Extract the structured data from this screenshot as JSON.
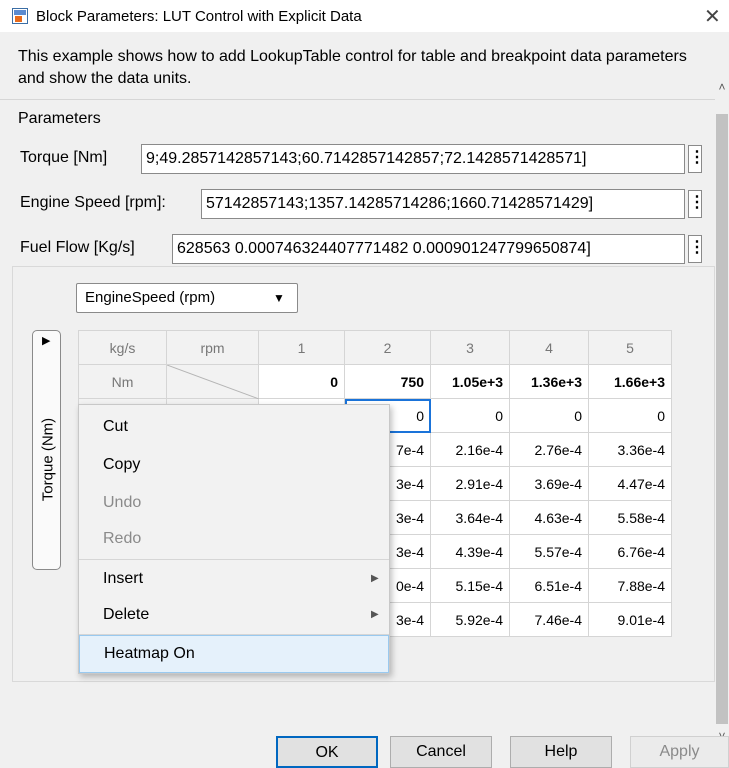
{
  "window": {
    "title": "Block Parameters: LUT Control with Explicit Data",
    "close_glyph": "✕",
    "icon": "simulink-block-icon"
  },
  "description": "This example shows how to add LookupTable control for table and breakpoint data  parameters and show the data units.",
  "parameters": {
    "title": "Parameters",
    "fields": [
      {
        "label": "Torque [Nm]",
        "value": "9;49.2857142857143;60.7142857142857;72.1428571428571]"
      },
      {
        "label": "Engine Speed [rpm]:",
        "value": "57142857143;1357.14285714286;1660.71428571429]"
      },
      {
        "label": "Fuel Flow [Kg/s]",
        "value": "628563 0.000746324407771482 0.000901247799650874]"
      }
    ],
    "menu_glyph": "⋮"
  },
  "lut": {
    "dimension_select": "EngineSpeed (rpm)",
    "vertical_axis_label": "Torque (Nm)",
    "table_units": "kg/s",
    "col_axis_units": "rpm",
    "row_axis_units": "Nm",
    "col_indices": [
      "1",
      "2",
      "3",
      "4",
      "5"
    ],
    "col_breakpoints": [
      "0",
      "750",
      "1.05e+3",
      "1.36e+3",
      "1.66e+3"
    ],
    "rows": [
      [
        "",
        "0",
        "0",
        "0",
        "0"
      ],
      [
        "7e-4",
        "2.16e-4",
        "2.76e-4",
        "3.36e-4"
      ],
      [
        "3e-4",
        "2.91e-4",
        "3.69e-4",
        "4.47e-4"
      ],
      [
        "3e-4",
        "3.64e-4",
        "4.63e-4",
        "5.58e-4"
      ],
      [
        "3e-4",
        "4.39e-4",
        "5.57e-4",
        "6.76e-4"
      ],
      [
        "0e-4",
        "5.15e-4",
        "6.51e-4",
        "7.88e-4"
      ],
      [
        "3e-4",
        "5.92e-4",
        "7.46e-4",
        "9.01e-4"
      ]
    ]
  },
  "context_menu": {
    "items": [
      {
        "label": "Cut",
        "enabled": true
      },
      {
        "label": "Copy",
        "enabled": true
      },
      {
        "label": "Undo",
        "enabled": false
      },
      {
        "label": "Redo",
        "enabled": false
      },
      {
        "label": "Insert",
        "enabled": true,
        "submenu": true
      },
      {
        "label": "Delete",
        "enabled": true,
        "submenu": true
      },
      {
        "label": "Heatmap On",
        "enabled": true,
        "highlighted": true
      }
    ]
  },
  "buttons": {
    "ok": "OK",
    "cancel": "Cancel",
    "help": "Help",
    "apply": "Apply"
  }
}
